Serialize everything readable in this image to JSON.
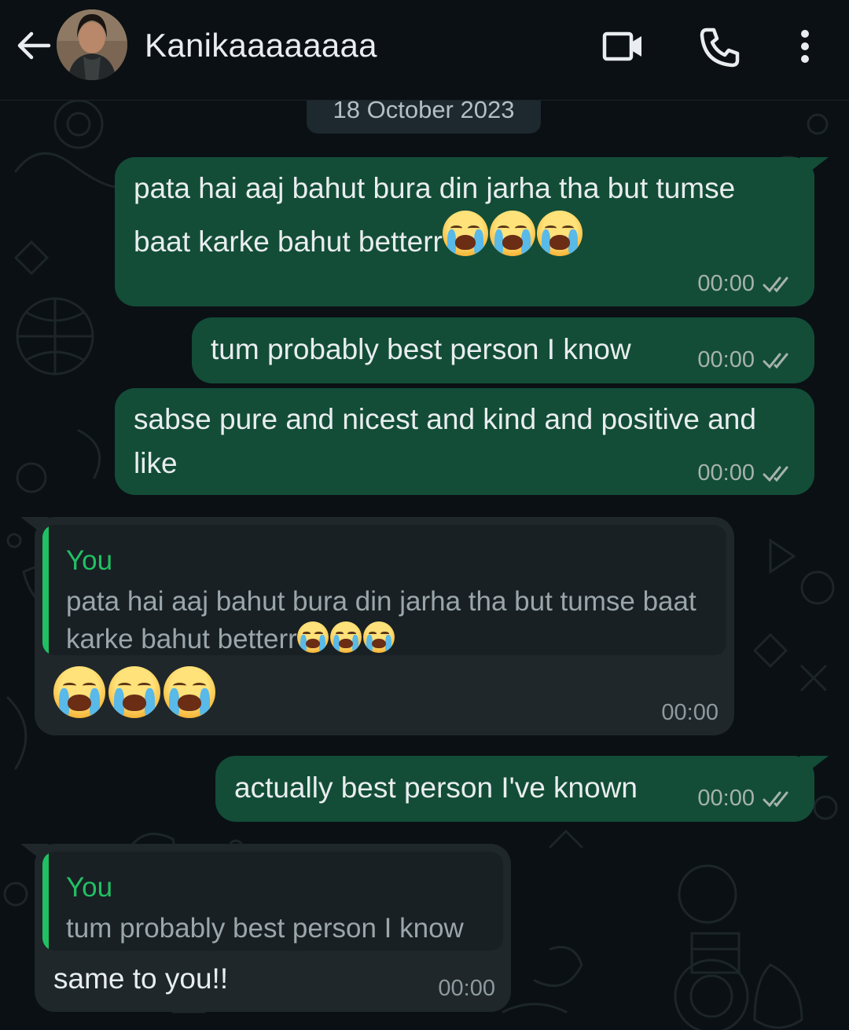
{
  "header": {
    "contact_name": "Kanikaaaaaaaa"
  },
  "icons": {
    "back": "arrow-left-icon",
    "video_call": "video-camera-icon",
    "voice_call": "phone-icon",
    "menu": "more-vertical-icon"
  },
  "colors": {
    "outgoing_bubble": "#134d37",
    "incoming_bubble": "#1f272a",
    "accent": "#21c063",
    "background": "#0b1014"
  },
  "date_chip": "18 October 2023",
  "messages": [
    {
      "direction": "outgoing",
      "text": "pata hai aaj bahut bura din jarha tha but tumse baat karke bahut betterr",
      "emoji": "loudly-crying-face-x3",
      "time": "00:00",
      "status": "read"
    },
    {
      "direction": "outgoing",
      "text": "tum probably best person I know",
      "time": "00:00",
      "status": "read"
    },
    {
      "direction": "outgoing",
      "text": "sabse pure and nicest and kind and positive and like",
      "time": "00:00",
      "status": "read"
    },
    {
      "direction": "incoming",
      "reply_author": "You",
      "reply_text": "pata hai aaj bahut bura din jarha tha but tumse baat karke bahut betterr",
      "reply_emoji": "loudly-crying-face-x3",
      "emoji": "loudly-crying-face-x3",
      "time": "00:00"
    },
    {
      "direction": "outgoing",
      "text": "actually best person I've known",
      "time": "00:00",
      "status": "read"
    },
    {
      "direction": "incoming",
      "reply_author": "You",
      "reply_text": "tum probably best person I know",
      "text": "same to you!!",
      "time": "00:00"
    }
  ]
}
